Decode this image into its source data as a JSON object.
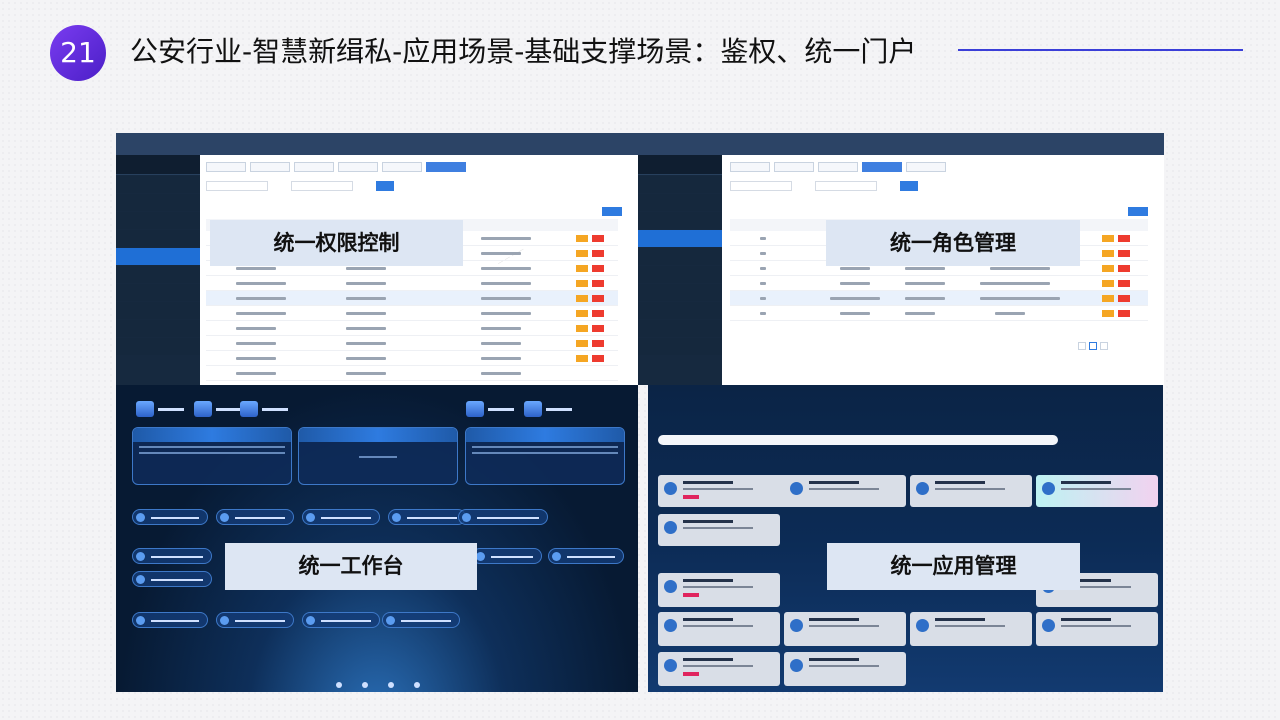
{
  "slide": {
    "number": "21",
    "title": "公安行业-智慧新缉私-应用场景-基础支撑场景：鉴权、统一门户"
  },
  "labels": {
    "permission": "统一权限控制",
    "role": "统一角色管理",
    "workbench": "统一工作台",
    "app_management": "统一应用管理"
  },
  "colors": {
    "accent": "#3b3fd8",
    "badge": "#5a2ee0"
  }
}
